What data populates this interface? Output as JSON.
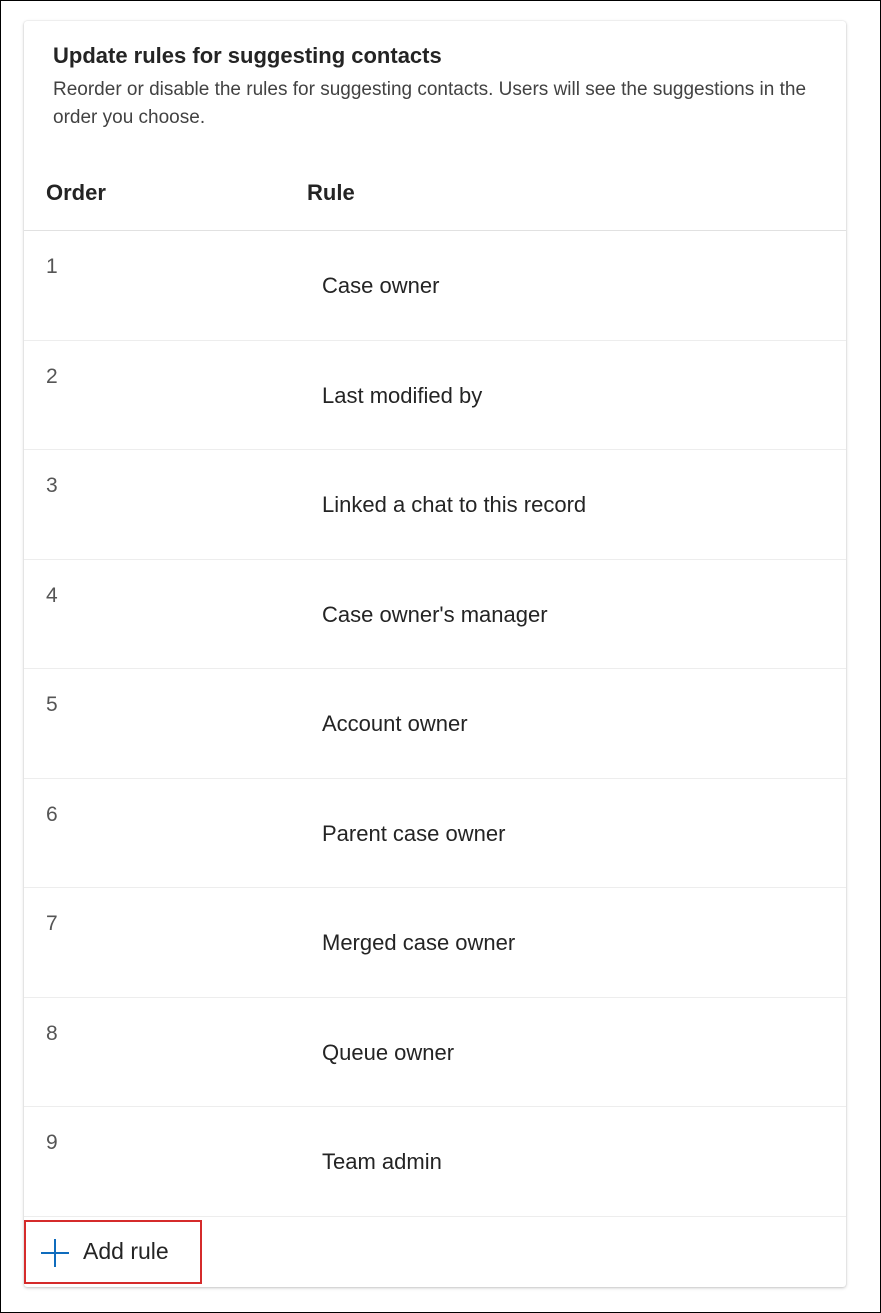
{
  "panel": {
    "title": "Update rules for suggesting contacts",
    "description": "Reorder or disable the rules for suggesting contacts. Users will see the suggestions in the order you choose."
  },
  "table": {
    "headers": {
      "order": "Order",
      "rule": "Rule"
    },
    "rows": [
      {
        "order": "1",
        "rule": "Case owner"
      },
      {
        "order": "2",
        "rule": "Last modified by"
      },
      {
        "order": "3",
        "rule": "Linked a chat to this record"
      },
      {
        "order": "4",
        "rule": "Case owner's manager"
      },
      {
        "order": "5",
        "rule": "Account owner"
      },
      {
        "order": "6",
        "rule": "Parent case owner"
      },
      {
        "order": "7",
        "rule": "Merged case owner"
      },
      {
        "order": "8",
        "rule": "Queue owner"
      },
      {
        "order": "9",
        "rule": "Team admin"
      }
    ]
  },
  "actions": {
    "add_rule_label": "Add rule",
    "add_rule_icon": "plus-icon"
  },
  "colors": {
    "accent": "#0f6cbd",
    "highlight_border": "#d52b2b"
  }
}
